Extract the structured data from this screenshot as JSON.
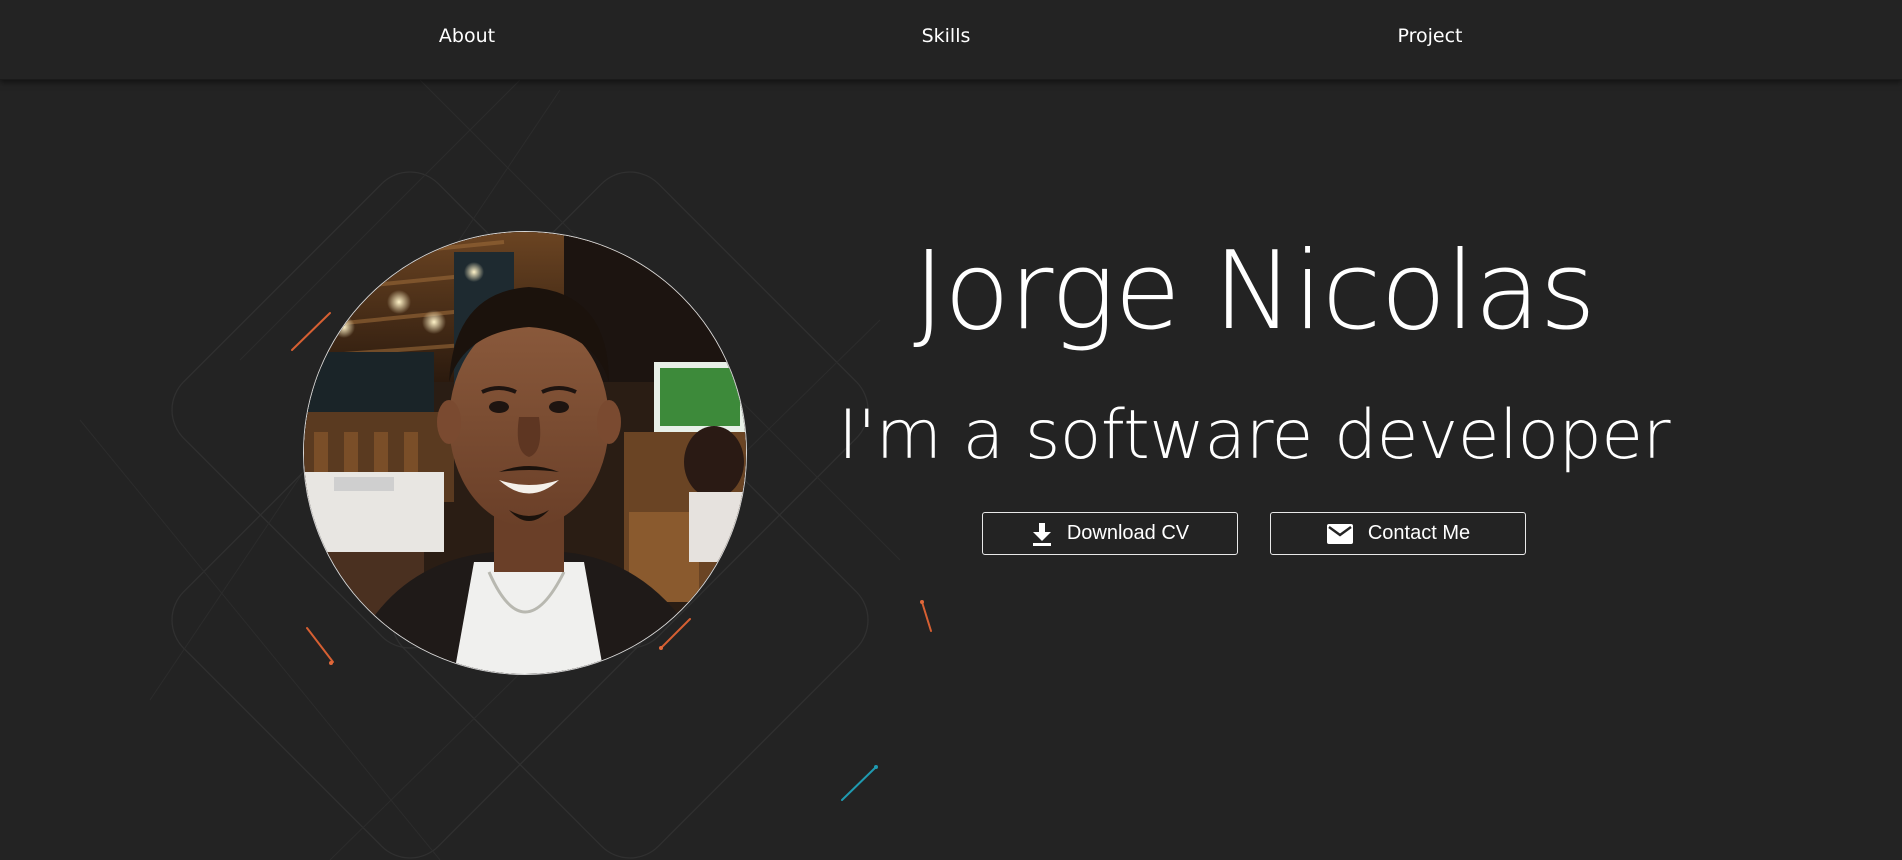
{
  "nav": {
    "items": [
      {
        "label": "About"
      },
      {
        "label": "Skills"
      },
      {
        "label": "Project"
      }
    ]
  },
  "hero": {
    "name": "Jorge Nicolas",
    "tagline": "I'm a software developer",
    "buttons": {
      "download_cv": {
        "label": "Download CV",
        "icon": "download-icon"
      },
      "contact_me": {
        "label": "Contact Me",
        "icon": "mail-icon"
      }
    },
    "photo": {
      "icon": "profile-photo"
    }
  },
  "colors": {
    "background": "#232323",
    "text": "#ffffff",
    "accent_orange": "#e0683a",
    "accent_teal": "#1f9ab0"
  }
}
